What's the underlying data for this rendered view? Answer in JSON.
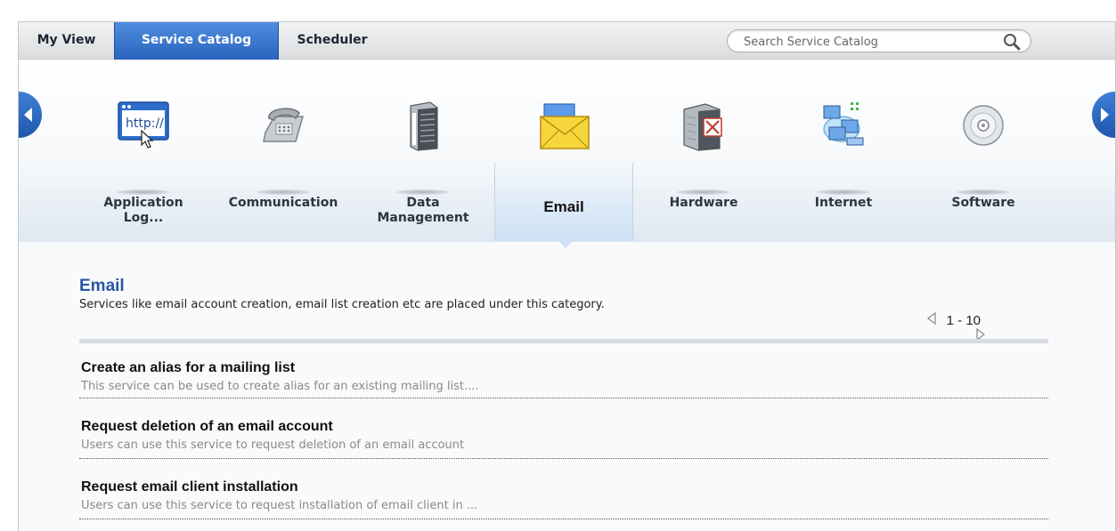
{
  "tabs": {
    "my_view": "My View",
    "service_catalog": "Service Catalog",
    "scheduler": "Scheduler"
  },
  "search": {
    "placeholder": "Search Service Catalog"
  },
  "categories": [
    {
      "label_line1": "Application",
      "label_line2": "Log...",
      "icon": "browser-http-icon"
    },
    {
      "label_line1": "Communication",
      "label_line2": "",
      "icon": "telephone-icon"
    },
    {
      "label_line1": "Data",
      "label_line2": "Management",
      "icon": "server-rack-icon"
    },
    {
      "label_line1": "Email",
      "label_line2": "",
      "icon": "envelope-icon",
      "selected": true
    },
    {
      "label_line1": "Hardware",
      "label_line2": "",
      "icon": "hardware-server-icon"
    },
    {
      "label_line1": "Internet",
      "label_line2": "",
      "icon": "network-computers-icon"
    },
    {
      "label_line1": "Software",
      "label_line2": "",
      "icon": "cd-disc-icon"
    }
  ],
  "content": {
    "title": "Email",
    "description": "Services like email account creation, email list creation etc are placed under this category.",
    "pager": "1 - 10"
  },
  "services": [
    {
      "title": "Create an alias for a mailing list",
      "description": "This service can be used to create alias for an existing mailing list...."
    },
    {
      "title": "Request deletion of an email account",
      "description": "Users can use this service to request deletion of an email account"
    },
    {
      "title": "Request email client installation",
      "description": "Users can use this service to request installation of email client in ..."
    }
  ],
  "colors": {
    "accent": "#2a63bd",
    "title_blue": "#2b55a5"
  }
}
